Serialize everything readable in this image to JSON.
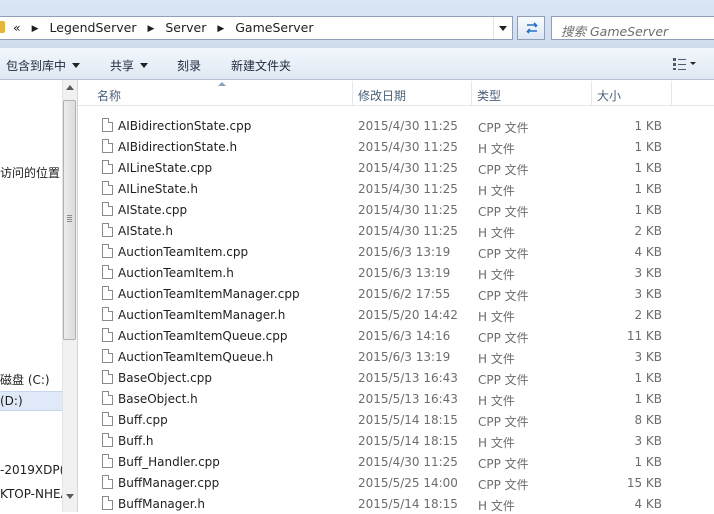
{
  "address": {
    "chevron": "«",
    "crumbs": [
      "LegendServer",
      "Server",
      "GameServer"
    ]
  },
  "search": {
    "placeholder": "搜索 GameServer"
  },
  "toolbar": {
    "include_library": "包含到库中",
    "share": "共享",
    "burn": "刻录",
    "new_folder": "新建文件夹"
  },
  "nav": {
    "items": [
      {
        "label": "访问的位置"
      },
      {
        "label": "磁盘 (C:)"
      },
      {
        "label": "(D:)"
      },
      {
        "label": "-2019XDP("
      },
      {
        "label": "KTOP-NHEA"
      }
    ]
  },
  "columns": {
    "name": "名称",
    "date": "修改日期",
    "type": "类型",
    "size": "大小"
  },
  "files": [
    {
      "name": "AIBidirectionState.cpp",
      "date": "2015/4/30 11:25",
      "type": "CPP 文件",
      "size": "1 KB"
    },
    {
      "name": "AIBidirectionState.h",
      "date": "2015/4/30 11:25",
      "type": "H 文件",
      "size": "1 KB"
    },
    {
      "name": "AILineState.cpp",
      "date": "2015/4/30 11:25",
      "type": "CPP 文件",
      "size": "1 KB"
    },
    {
      "name": "AILineState.h",
      "date": "2015/4/30 11:25",
      "type": "H 文件",
      "size": "1 KB"
    },
    {
      "name": "AIState.cpp",
      "date": "2015/4/30 11:25",
      "type": "CPP 文件",
      "size": "1 KB"
    },
    {
      "name": "AIState.h",
      "date": "2015/4/30 11:25",
      "type": "H 文件",
      "size": "2 KB"
    },
    {
      "name": "AuctionTeamItem.cpp",
      "date": "2015/6/3 13:19",
      "type": "CPP 文件",
      "size": "4 KB"
    },
    {
      "name": "AuctionTeamItem.h",
      "date": "2015/6/3 13:19",
      "type": "H 文件",
      "size": "3 KB"
    },
    {
      "name": "AuctionTeamItemManager.cpp",
      "date": "2015/6/2 17:55",
      "type": "CPP 文件",
      "size": "3 KB"
    },
    {
      "name": "AuctionTeamItemManager.h",
      "date": "2015/5/20 14:42",
      "type": "H 文件",
      "size": "2 KB"
    },
    {
      "name": "AuctionTeamItemQueue.cpp",
      "date": "2015/6/3 14:16",
      "type": "CPP 文件",
      "size": "11 KB"
    },
    {
      "name": "AuctionTeamItemQueue.h",
      "date": "2015/6/3 13:19",
      "type": "H 文件",
      "size": "3 KB"
    },
    {
      "name": "BaseObject.cpp",
      "date": "2015/5/13 16:43",
      "type": "CPP 文件",
      "size": "1 KB"
    },
    {
      "name": "BaseObject.h",
      "date": "2015/5/13 16:43",
      "type": "H 文件",
      "size": "1 KB"
    },
    {
      "name": "Buff.cpp",
      "date": "2015/5/14 18:15",
      "type": "CPP 文件",
      "size": "8 KB"
    },
    {
      "name": "Buff.h",
      "date": "2015/5/14 18:15",
      "type": "H 文件",
      "size": "3 KB"
    },
    {
      "name": "Buff_Handler.cpp",
      "date": "2015/4/30 11:25",
      "type": "CPP 文件",
      "size": "1 KB"
    },
    {
      "name": "BuffManager.cpp",
      "date": "2015/5/25 14:00",
      "type": "CPP 文件",
      "size": "15 KB"
    },
    {
      "name": "BuffManager.h",
      "date": "2015/5/14 18:15",
      "type": "H 文件",
      "size": "4 KB"
    }
  ]
}
